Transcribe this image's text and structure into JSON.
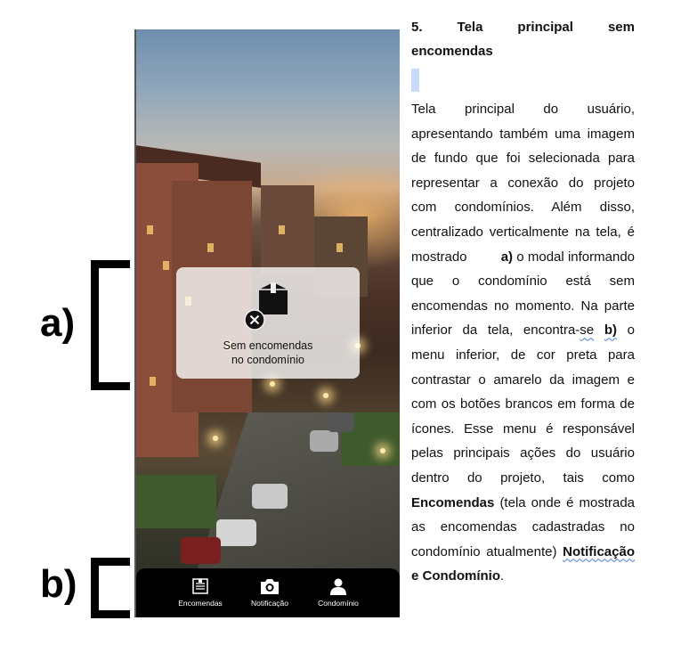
{
  "annotations": {
    "a_label": "a)",
    "b_label": "b)"
  },
  "modal": {
    "icon": "package-box-icon",
    "status_icon": "close-circle-icon",
    "message_line1": "Sem encomendas",
    "message_line2": "no condomínio"
  },
  "bottom_nav": {
    "items": [
      {
        "label": "Encomendas",
        "icon": "package-list-icon"
      },
      {
        "label": "Notificação",
        "icon": "camera-icon"
      },
      {
        "label": "Condomínio",
        "icon": "person-icon"
      }
    ],
    "background": "#000000"
  },
  "doc": {
    "title_number": "5.",
    "title_w1": "Tela",
    "title_w2": "principal",
    "title_w3": "sem",
    "title_w4": "encomendas",
    "p1": "Tela principal do usuário, apresentando também uma imagem de fundo que foi selecionada para representar a conexão do projeto com condomínios. Além disso, centralizado verticalmente na tela, é mostrado",
    "a_ref": "a)",
    "p2": "o modal informando que o condomínio está sem encomendas no momento. Na parte inferior da tela, encontra-",
    "se": "se",
    "b_ref": "b)",
    "p3": "o menu inferior, de cor preta para contrastar o amarelo da imagem e com os botões brancos em forma de ícones. Esse menu é responsável pelas principais ações do usuário dentro do projeto, tais como",
    "enc_word": "Encomendas",
    "p4": "(tela onde é mostrada as encomendas cadastradas no condomínio atualmente)",
    "notif_word": "Notificação",
    "e_word": "e",
    "cond_word": "Condomínio",
    "end_dot": "."
  }
}
